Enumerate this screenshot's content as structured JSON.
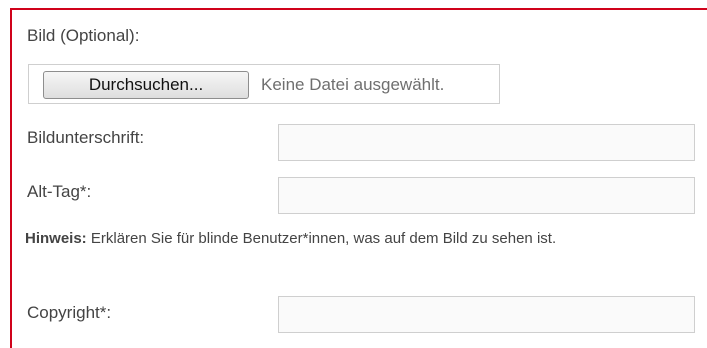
{
  "form": {
    "image_label": "Bild (Optional):",
    "browse_button": "Durchsuchen...",
    "file_status": "Keine Datei ausgewählt.",
    "caption_label": "Bildunterschrift:",
    "caption_value": "",
    "alt_label": "Alt-Tag*:",
    "alt_value": "",
    "hint_bold": "Hinweis:",
    "hint_text": " Erklären Sie für blinde Benutzer*innen, was auf dem Bild zu sehen ist.",
    "copyright_label": "Copyright*:",
    "copyright_value": ""
  },
  "colors": {
    "frame_border": "#d0021b",
    "label_text": "#444444",
    "input_border": "#cfcfcf"
  }
}
